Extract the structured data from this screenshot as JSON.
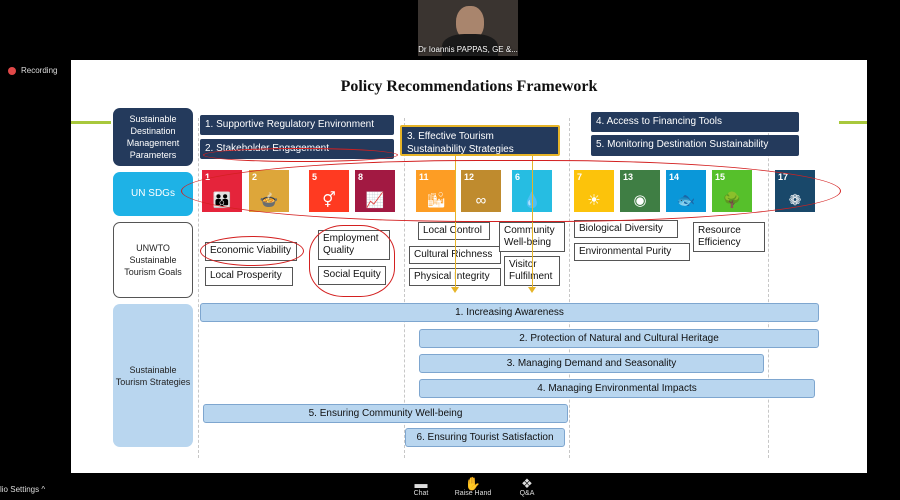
{
  "meeting": {
    "participant_name": "Dr Ioannis PAPPAS, GE &...",
    "recording_label": "Recording",
    "audio_settings_label": "lio Settings",
    "audio_caret": "^",
    "controls": [
      {
        "label": "Chat",
        "icon": "chat-icon",
        "glyph": "▬"
      },
      {
        "label": "Raise Hand",
        "icon": "hand-icon",
        "glyph": "✋"
      },
      {
        "label": "Q&A",
        "icon": "qa-icon",
        "glyph": "❖"
      }
    ]
  },
  "slide": {
    "title": "Policy Recommendations Framework",
    "row_labels": {
      "params": "Sustainable Destination Management Parameters",
      "sdgs": "UN SDGs",
      "goals": "UNWTO Sustainable Tourism Goals",
      "strategies": "Sustainable Tourism Strategies"
    },
    "parameters": [
      "1. Supportive Regulatory Environment",
      "2. Stakeholder Engagement",
      "3. Effective Tourism Sustainability Strategies",
      "4. Access to Financing Tools",
      "5. Monitoring Destination Sustainability"
    ],
    "sdgs": [
      {
        "num": "1",
        "color": "#e5243b",
        "icon": "people-icon",
        "glyph": "👪"
      },
      {
        "num": "2",
        "color": "#dda63a",
        "icon": "bowl-icon",
        "glyph": "🍲"
      },
      {
        "num": "5",
        "color": "#ff3a21",
        "icon": "gender-icon",
        "glyph": "⚥"
      },
      {
        "num": "8",
        "color": "#a21942",
        "icon": "growth-icon",
        "glyph": "📈"
      },
      {
        "num": "11",
        "color": "#fd9d24",
        "icon": "city-icon",
        "glyph": "🏙"
      },
      {
        "num": "12",
        "color": "#bf8b2e",
        "icon": "infinity-icon",
        "glyph": "∞"
      },
      {
        "num": "6",
        "color": "#26bde2",
        "icon": "water-icon",
        "glyph": "💧"
      },
      {
        "num": "7",
        "color": "#fcc30b",
        "icon": "sun-icon",
        "glyph": "☀"
      },
      {
        "num": "13",
        "color": "#3f7e44",
        "icon": "eye-icon",
        "glyph": "◉"
      },
      {
        "num": "14",
        "color": "#0a97d9",
        "icon": "fish-icon",
        "glyph": "🐟"
      },
      {
        "num": "15",
        "color": "#56c02b",
        "icon": "tree-icon",
        "glyph": "🌳"
      },
      {
        "num": "17",
        "color": "#19486a",
        "icon": "partnership-icon",
        "glyph": "❁"
      }
    ],
    "goals": [
      "Economic Viability",
      "Local Prosperity",
      "Employment Quality",
      "Social Equity",
      "Local Control",
      "Cultural Richness",
      "Physical Integrity",
      "Community Well-being",
      "Visitor Fulfilment",
      "Biological Diversity",
      "Environmental Purity",
      "Resource Efficiency"
    ],
    "strategies": [
      "1. Increasing Awareness",
      "2. Protection of Natural and Cultural Heritage",
      "3. Managing Demand and Seasonality",
      "4. Managing Environmental Impacts",
      "5. Ensuring Community Well-being",
      "6. Ensuring Tourist Satisfaction"
    ]
  }
}
